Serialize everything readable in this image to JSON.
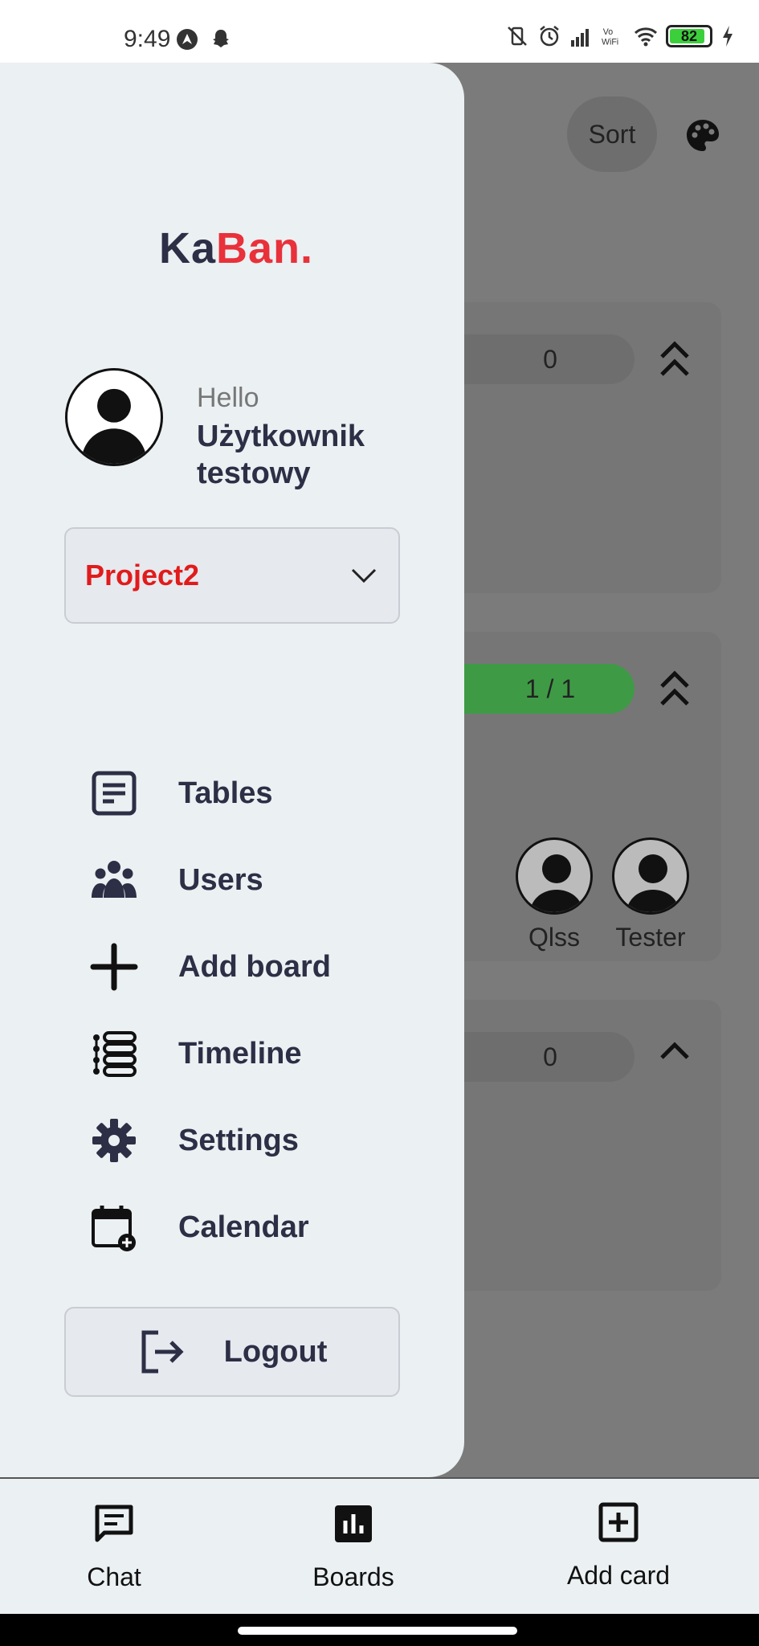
{
  "status_bar": {
    "time": "9:49",
    "battery_level": "82",
    "icons": [
      "autonav-icon",
      "snapchat-icon",
      "vibrate-off-icon",
      "alarm-icon",
      "signal-icon",
      "vowifi-icon",
      "wifi-icon",
      "battery-icon",
      "charging-icon"
    ]
  },
  "background": {
    "sort_label": "Sort",
    "columns": [
      {
        "counter": "0",
        "status": "gray"
      },
      {
        "counter": "1 / 1",
        "status": "green",
        "assignees": [
          "Qlss",
          "Tester"
        ]
      },
      {
        "counter": "0",
        "status": "gray"
      }
    ]
  },
  "drawer": {
    "logo_part1": "Ka",
    "logo_part2": "Ban.",
    "greeting": "Hello",
    "user_name": "Użytkownik testowy",
    "project": "Project2",
    "menu": [
      {
        "label": "Tables",
        "icon": "tables-icon"
      },
      {
        "label": "Users",
        "icon": "users-icon"
      },
      {
        "label": "Add board",
        "icon": "plus-icon"
      },
      {
        "label": "Timeline",
        "icon": "timeline-icon"
      },
      {
        "label": "Settings",
        "icon": "gear-icon"
      },
      {
        "label": "Calendar",
        "icon": "calendar-icon"
      }
    ],
    "logout_label": "Logout"
  },
  "bottom_nav": {
    "items": [
      {
        "label": "Chat",
        "icon": "chat-icon"
      },
      {
        "label": "Boards",
        "icon": "boards-icon"
      },
      {
        "label": "Add card",
        "icon": "add-card-icon"
      }
    ]
  },
  "colors": {
    "accent": "#e8313a",
    "project": "#e11b1b",
    "progress_green": "#3f9a46",
    "drawer_bg": "#ebf0f2",
    "text_dark": "#2c2f45"
  }
}
